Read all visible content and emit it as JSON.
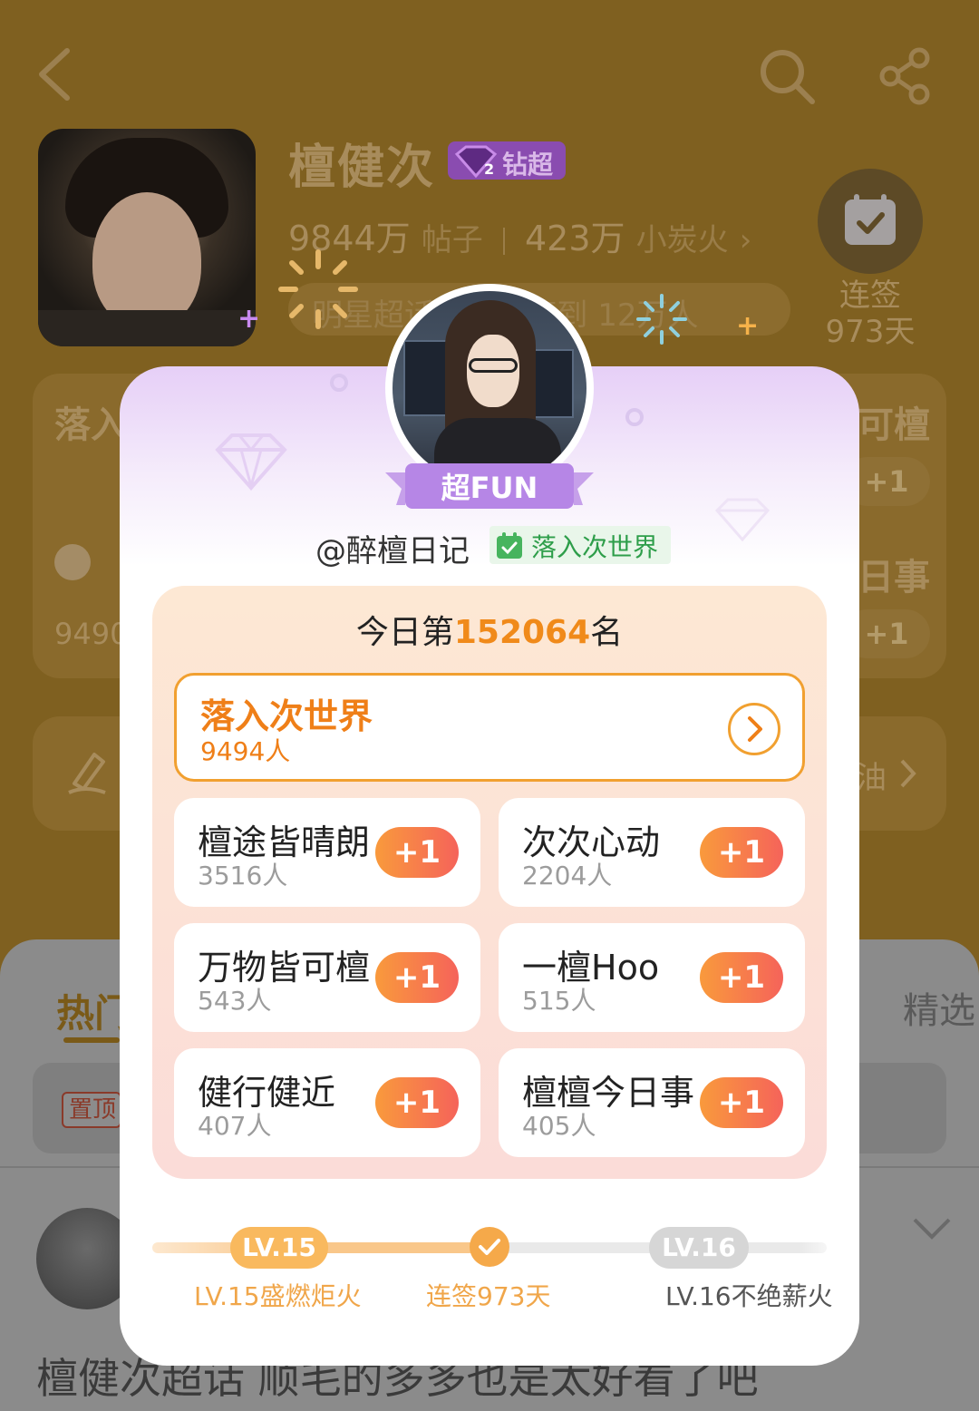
{
  "page": {
    "title": "檀健次",
    "badge_label": "钻超",
    "stats": {
      "posts_value": "9844万",
      "posts_label": "帖子",
      "fans_value": "423万",
      "fans_label": "小炭火",
      "chevron": "›"
    },
    "checkin_pill": "明星超话 · 今日签到 12万人",
    "checkin_label_1": "连签",
    "checkin_label_2": "973天",
    "bg_card_left_title": "落入",
    "bg_card_left_count": "9490",
    "bg_card_right_title_1": "可檀",
    "bg_card_right_title_2": "日事",
    "bg_plus": "+1",
    "bg_pill_text": "油",
    "tabs": {
      "hot": "热门",
      "featured": "精选"
    },
    "pinned_label": "置顶",
    "post_text": "檀健次超话 顺毛的多多也是太好看了吧"
  },
  "modal": {
    "ribbon_label": "超FUN",
    "username": "@醉檀日记",
    "world_tag": "落入次世界",
    "rank_prefix": "今日第",
    "rank_number": "152064",
    "rank_suffix": "名",
    "featured_group": {
      "name": "落入次世界",
      "count": "9494人"
    },
    "groups": [
      {
        "name": "檀途皆晴朗",
        "count": "3516人",
        "action": "+1"
      },
      {
        "name": "次次心动",
        "count": "2204人",
        "action": "+1"
      },
      {
        "name": "万物皆可檀",
        "count": "543人",
        "action": "+1"
      },
      {
        "name": "一檀Hoo",
        "count": "515人",
        "action": "+1"
      },
      {
        "name": "健行健近",
        "count": "407人",
        "action": "+1"
      },
      {
        "name": "檀檀今日事",
        "count": "405人",
        "action": "+1"
      }
    ],
    "level": {
      "current_badge": "LV.15",
      "current_label": "LV.15盛燃炬火",
      "streak_label": "连签973天",
      "next_badge": "LV.16",
      "next_label": "LV.16不绝薪火"
    }
  },
  "colors": {
    "accent_orange": "#f08a1a",
    "plus_gradient_start": "#f99a3c",
    "plus_gradient_end": "#f5635a",
    "tag_green": "#2e9e4a",
    "modal_lavender": "#e6cff7"
  },
  "icons": [
    "back-arrow-icon",
    "search-icon",
    "share-icon",
    "calendar-check-icon",
    "diamond-icon",
    "chevron-right-icon",
    "chevron-down-icon",
    "check-icon"
  ]
}
